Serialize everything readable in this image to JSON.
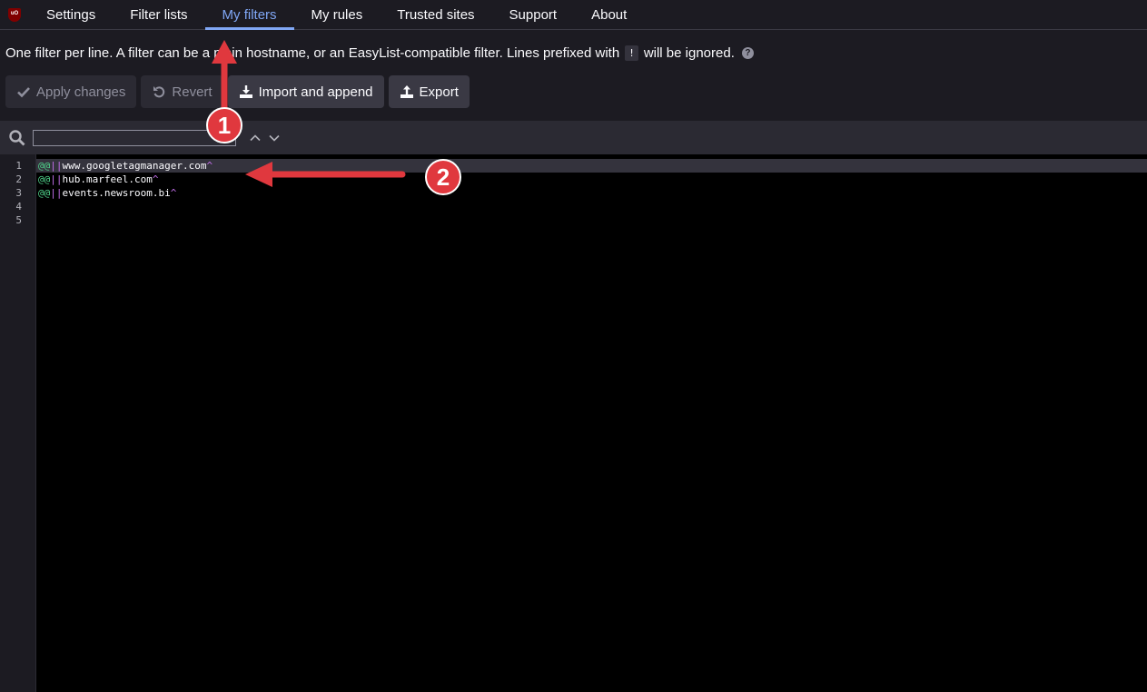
{
  "nav": {
    "logo_text": "uO",
    "tabs": [
      {
        "label": "Settings"
      },
      {
        "label": "Filter lists"
      },
      {
        "label": "My filters",
        "active": true
      },
      {
        "label": "My rules"
      },
      {
        "label": "Trusted sites"
      },
      {
        "label": "Support"
      },
      {
        "label": "About"
      }
    ]
  },
  "description": {
    "text_before": "One filter per line. A filter can be a plain hostname, or an EasyList-compatible filter. Lines prefixed with",
    "code": "!",
    "text_after": "will be ignored.",
    "help_icon": "question-circle-icon"
  },
  "toolbar": {
    "apply_label": "Apply changes",
    "revert_label": "Revert",
    "import_label": "Import and append",
    "export_label": "Export"
  },
  "search": {
    "value": "",
    "placeholder": ""
  },
  "editor": {
    "line_numbers": [
      "1",
      "2",
      "3",
      "4",
      "5"
    ],
    "lines": [
      {
        "exception": "@@",
        "anchor": "||",
        "host": "www.googletagmanager.com",
        "caret": "^"
      },
      {
        "exception": "@@",
        "anchor": "||",
        "host": "hub.marfeel.com",
        "caret": "^"
      },
      {
        "exception": "@@",
        "anchor": "||",
        "host": "events.newsroom.bi",
        "caret": "^"
      },
      {
        "exception": "",
        "anchor": "",
        "host": "",
        "caret": ""
      },
      {
        "exception": "",
        "anchor": "",
        "host": "",
        "caret": ""
      }
    ]
  },
  "annotations": {
    "badge_1": "1",
    "badge_2": "2",
    "color": "#e0383e"
  },
  "colors": {
    "accent": "#80a7f5",
    "background": "#1c1b22",
    "editor_bg": "#000000"
  }
}
